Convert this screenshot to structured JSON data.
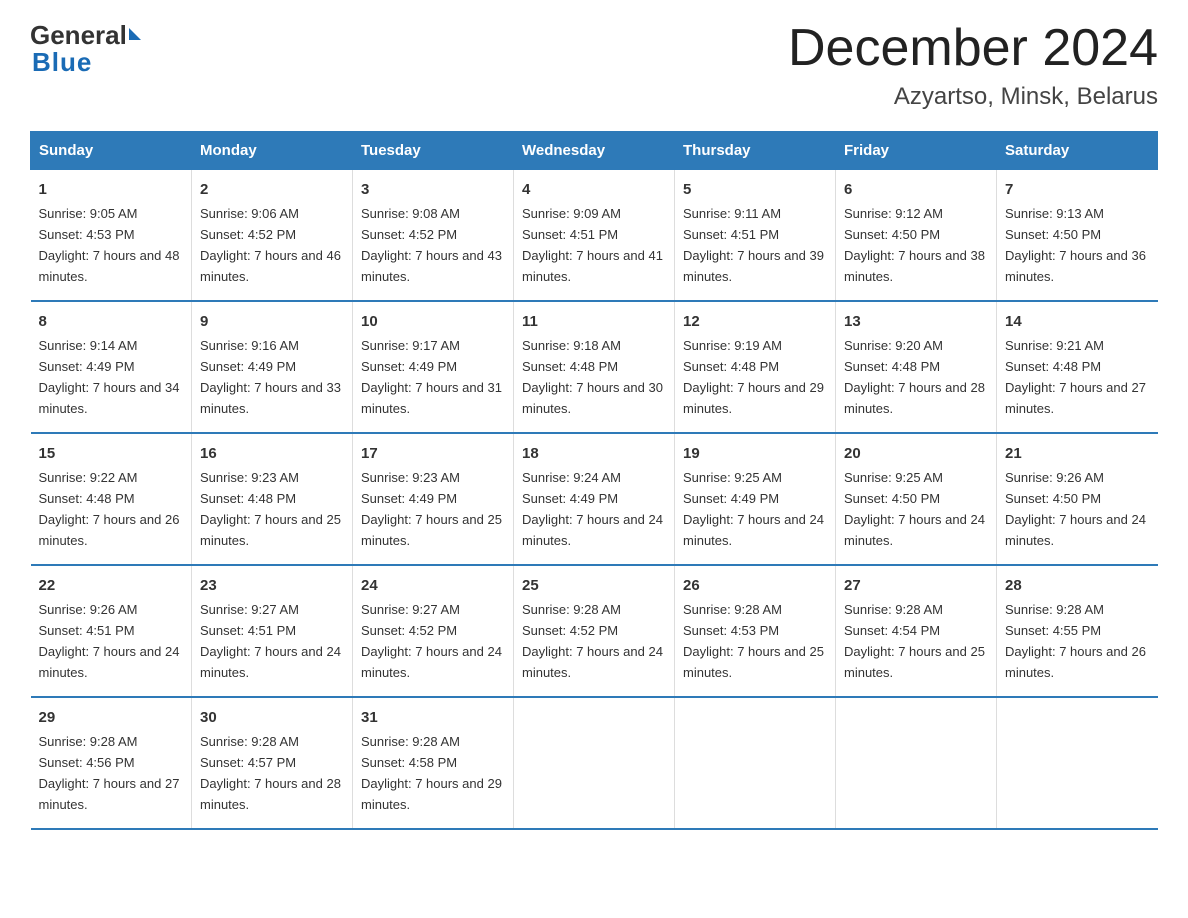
{
  "header": {
    "logo_general": "General",
    "logo_blue": "Blue",
    "month_title": "December 2024",
    "location": "Azyartso, Minsk, Belarus"
  },
  "days_of_week": [
    "Sunday",
    "Monday",
    "Tuesday",
    "Wednesday",
    "Thursday",
    "Friday",
    "Saturday"
  ],
  "weeks": [
    [
      {
        "day": "1",
        "sunrise": "9:05 AM",
        "sunset": "4:53 PM",
        "daylight": "7 hours and 48 minutes."
      },
      {
        "day": "2",
        "sunrise": "9:06 AM",
        "sunset": "4:52 PM",
        "daylight": "7 hours and 46 minutes."
      },
      {
        "day": "3",
        "sunrise": "9:08 AM",
        "sunset": "4:52 PM",
        "daylight": "7 hours and 43 minutes."
      },
      {
        "day": "4",
        "sunrise": "9:09 AM",
        "sunset": "4:51 PM",
        "daylight": "7 hours and 41 minutes."
      },
      {
        "day": "5",
        "sunrise": "9:11 AM",
        "sunset": "4:51 PM",
        "daylight": "7 hours and 39 minutes."
      },
      {
        "day": "6",
        "sunrise": "9:12 AM",
        "sunset": "4:50 PM",
        "daylight": "7 hours and 38 minutes."
      },
      {
        "day": "7",
        "sunrise": "9:13 AM",
        "sunset": "4:50 PM",
        "daylight": "7 hours and 36 minutes."
      }
    ],
    [
      {
        "day": "8",
        "sunrise": "9:14 AM",
        "sunset": "4:49 PM",
        "daylight": "7 hours and 34 minutes."
      },
      {
        "day": "9",
        "sunrise": "9:16 AM",
        "sunset": "4:49 PM",
        "daylight": "7 hours and 33 minutes."
      },
      {
        "day": "10",
        "sunrise": "9:17 AM",
        "sunset": "4:49 PM",
        "daylight": "7 hours and 31 minutes."
      },
      {
        "day": "11",
        "sunrise": "9:18 AM",
        "sunset": "4:48 PM",
        "daylight": "7 hours and 30 minutes."
      },
      {
        "day": "12",
        "sunrise": "9:19 AM",
        "sunset": "4:48 PM",
        "daylight": "7 hours and 29 minutes."
      },
      {
        "day": "13",
        "sunrise": "9:20 AM",
        "sunset": "4:48 PM",
        "daylight": "7 hours and 28 minutes."
      },
      {
        "day": "14",
        "sunrise": "9:21 AM",
        "sunset": "4:48 PM",
        "daylight": "7 hours and 27 minutes."
      }
    ],
    [
      {
        "day": "15",
        "sunrise": "9:22 AM",
        "sunset": "4:48 PM",
        "daylight": "7 hours and 26 minutes."
      },
      {
        "day": "16",
        "sunrise": "9:23 AM",
        "sunset": "4:48 PM",
        "daylight": "7 hours and 25 minutes."
      },
      {
        "day": "17",
        "sunrise": "9:23 AM",
        "sunset": "4:49 PM",
        "daylight": "7 hours and 25 minutes."
      },
      {
        "day": "18",
        "sunrise": "9:24 AM",
        "sunset": "4:49 PM",
        "daylight": "7 hours and 24 minutes."
      },
      {
        "day": "19",
        "sunrise": "9:25 AM",
        "sunset": "4:49 PM",
        "daylight": "7 hours and 24 minutes."
      },
      {
        "day": "20",
        "sunrise": "9:25 AM",
        "sunset": "4:50 PM",
        "daylight": "7 hours and 24 minutes."
      },
      {
        "day": "21",
        "sunrise": "9:26 AM",
        "sunset": "4:50 PM",
        "daylight": "7 hours and 24 minutes."
      }
    ],
    [
      {
        "day": "22",
        "sunrise": "9:26 AM",
        "sunset": "4:51 PM",
        "daylight": "7 hours and 24 minutes."
      },
      {
        "day": "23",
        "sunrise": "9:27 AM",
        "sunset": "4:51 PM",
        "daylight": "7 hours and 24 minutes."
      },
      {
        "day": "24",
        "sunrise": "9:27 AM",
        "sunset": "4:52 PM",
        "daylight": "7 hours and 24 minutes."
      },
      {
        "day": "25",
        "sunrise": "9:28 AM",
        "sunset": "4:52 PM",
        "daylight": "7 hours and 24 minutes."
      },
      {
        "day": "26",
        "sunrise": "9:28 AM",
        "sunset": "4:53 PM",
        "daylight": "7 hours and 25 minutes."
      },
      {
        "day": "27",
        "sunrise": "9:28 AM",
        "sunset": "4:54 PM",
        "daylight": "7 hours and 25 minutes."
      },
      {
        "day": "28",
        "sunrise": "9:28 AM",
        "sunset": "4:55 PM",
        "daylight": "7 hours and 26 minutes."
      }
    ],
    [
      {
        "day": "29",
        "sunrise": "9:28 AM",
        "sunset": "4:56 PM",
        "daylight": "7 hours and 27 minutes."
      },
      {
        "day": "30",
        "sunrise": "9:28 AM",
        "sunset": "4:57 PM",
        "daylight": "7 hours and 28 minutes."
      },
      {
        "day": "31",
        "sunrise": "9:28 AM",
        "sunset": "4:58 PM",
        "daylight": "7 hours and 29 minutes."
      },
      null,
      null,
      null,
      null
    ]
  ]
}
